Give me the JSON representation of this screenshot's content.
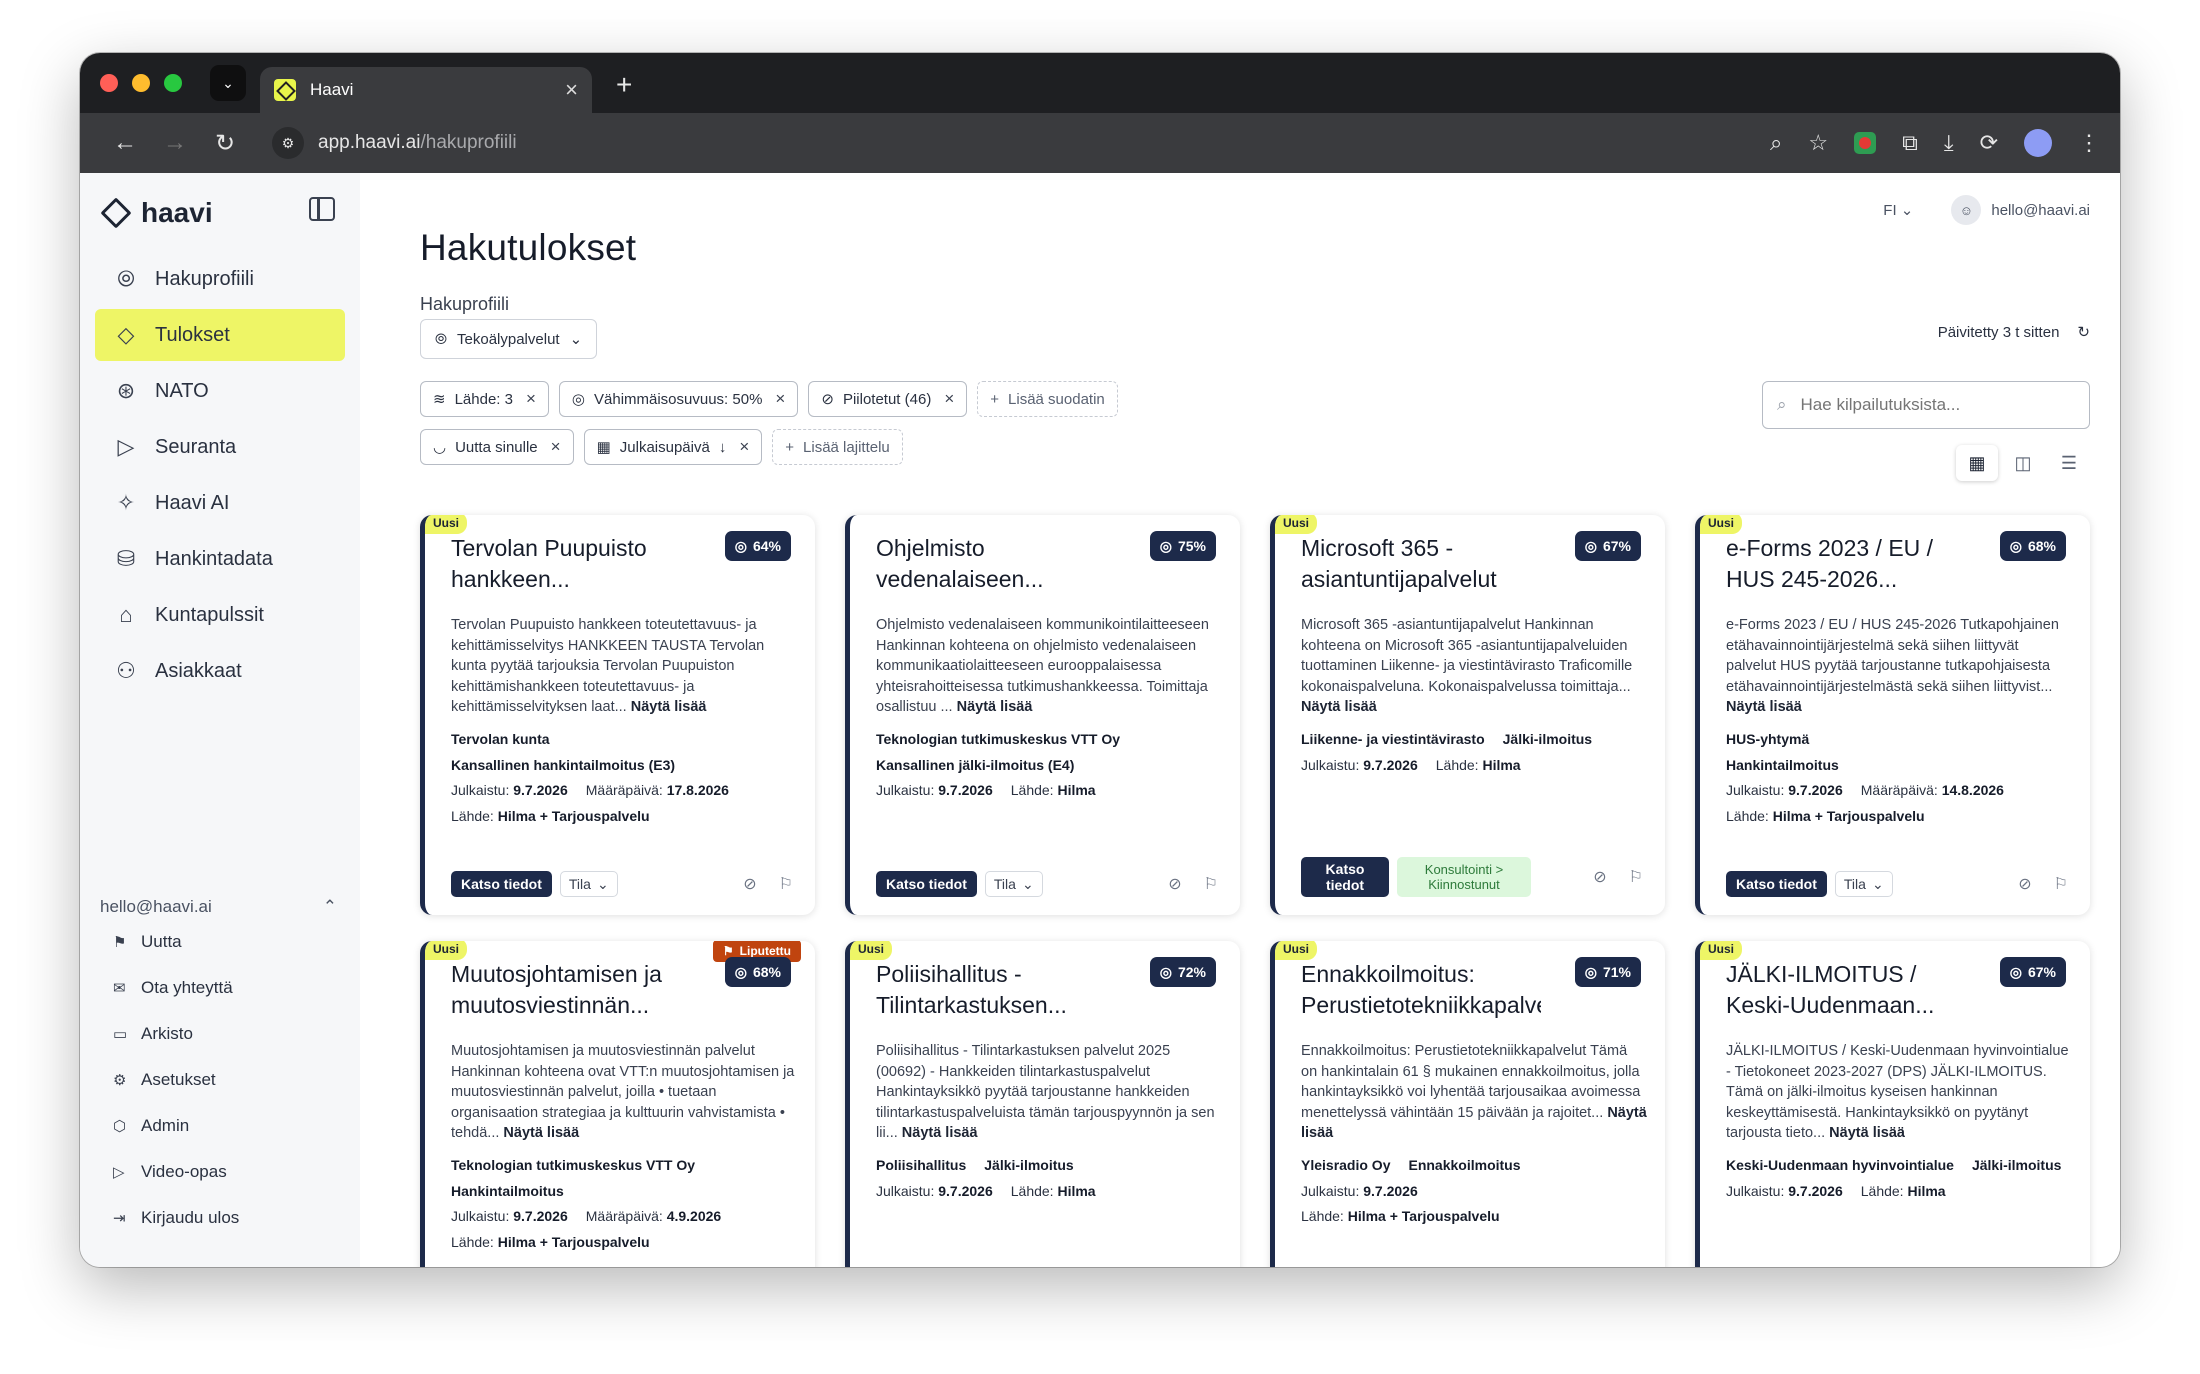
{
  "browser": {
    "tab_title": "Haavi",
    "url_host": "app.haavi.ai",
    "url_path": "/hakuprofiili"
  },
  "sidebar": {
    "logo": "haavi",
    "items": [
      {
        "label": "Hakuprofiili",
        "icon": "fingerprint-icon"
      },
      {
        "label": "Tulokset",
        "icon": "tag-icon"
      },
      {
        "label": "NATO",
        "icon": "compass-icon"
      },
      {
        "label": "Seuranta",
        "icon": "play-icon"
      },
      {
        "label": "Haavi AI",
        "icon": "sparkle-icon"
      },
      {
        "label": "Hankintadata",
        "icon": "database-icon"
      },
      {
        "label": "Kuntapulssit",
        "icon": "building-icon"
      },
      {
        "label": "Asiakkaat",
        "icon": "handshake-icon"
      }
    ],
    "account": {
      "email": "hello@haavi.ai",
      "items": [
        {
          "label": "Uutta",
          "icon": "megaphone-icon"
        },
        {
          "label": "Ota yhteyttä",
          "icon": "mail-icon"
        },
        {
          "label": "Arkisto",
          "icon": "archive-icon"
        },
        {
          "label": "Asetukset",
          "icon": "gear-icon"
        },
        {
          "label": "Admin",
          "icon": "shield-icon"
        },
        {
          "label": "Video-opas",
          "icon": "play-icon"
        },
        {
          "label": "Kirjaudu ulos",
          "icon": "logout-icon"
        }
      ]
    }
  },
  "header": {
    "lang": "FI",
    "user_email": "hello@haavi.ai",
    "title": "Hakutulokset",
    "profile_label": "Hakuprofiili",
    "profile_value": "Tekoälypalvelut",
    "updated": "Päivitetty 3 t sitten"
  },
  "filters": {
    "row1": [
      "Lähde: 3",
      "Vähimmäisosuvuus: 50%",
      "Piilotetut (46)"
    ],
    "add_filter": "Lisää suodatin",
    "row2": [
      "Uutta sinulle",
      "Julkaisupäivä"
    ],
    "add_sort": "Lisää lajittelu",
    "search_placeholder": "Hae kilpailutuksista..."
  },
  "labels": {
    "new": "Uusi",
    "show_more": "Näytä lisää",
    "details": "Katso tiedot",
    "status": "Tila",
    "flagged": "Liputettu",
    "published": "Julkaistu:",
    "deadline": "Määräpäivä:",
    "source": "Lähde:"
  },
  "cards": [
    {
      "new": true,
      "title": "Tervolan Puupuisto hankkeen...",
      "score": "64%",
      "desc": "Tervolan Puupuisto hankkeen toteutettavuus- ja kehittämisselvitys HANKKEEN TAUSTA Tervolan kunta pyytää tarjouksia Tervolan Puupuiston kehittämishankkeen toteutettavuus- ja kehittämisselvityksen laat...",
      "org": "Tervolan kunta",
      "type": "Kansallinen hankintailmoitus (E3)",
      "published": "9.7.2026",
      "deadline": "17.8.2026",
      "source": "Hilma + Tarjouspalvelu"
    },
    {
      "new": false,
      "title": "Ohjelmisto vedenalaiseen...",
      "score": "75%",
      "desc": "Ohjelmisto vedenalaiseen kommunikointilaitteeseen Hankinnan kohteena on ohjelmisto vedenalaiseen kommunikaatiolaitteeseen eurooppalaisessa yhteisrahoitteisessa tutkimushankkeessa. Toimittaja osallistuu ...",
      "org": "Teknologian tutkimuskeskus VTT Oy",
      "type": "Kansallinen jälki-ilmoitus (E4)",
      "published": "9.7.2026",
      "source": "Hilma"
    },
    {
      "new": true,
      "title": "Microsoft 365 - asiantuntijapalvelut",
      "score": "67%",
      "desc": "Microsoft 365 -asiantuntijapalvelut Hankinnan kohteena on Microsoft 365 -asiantuntijapalveluiden tuottaminen Liikenne- ja viestintävirasto Traficomille kokonaispalveluna. Kokonaispalvelussa toimittaja...",
      "org": "Liikenne- ja viestintävirasto",
      "type": "Jälki-ilmoitus",
      "published": "9.7.2026",
      "source": "Hilma",
      "status_label": "Konsultointi > Kiinnostunut"
    },
    {
      "new": true,
      "title": "e-Forms 2023 / EU / HUS 245-2026...",
      "score": "68%",
      "desc": "e-Forms 2023 / EU / HUS 245-2026 Tutkapohjainen etähavainnointijärjestelmä sekä siihen liittyvät palvelut HUS pyytää tarjoustanne tutkapohjaisesta etähavainnointijärjestelmästä sekä siihen liittyvist...",
      "org": "HUS-yhtymä",
      "type": "Hankintailmoitus",
      "published": "9.7.2026",
      "deadline": "14.8.2026",
      "source": "Hilma + Tarjouspalvelu"
    },
    {
      "new": true,
      "flagged": true,
      "title": "Muutosjohtamisen ja muutosviestinnän...",
      "score": "68%",
      "desc": "Muutosjohtamisen ja muutosviestinnän palvelut Hankinnan kohteena ovat VTT:n muutosjohtamisen ja muutosviestinnän palvelut, joilla • tuetaan organisaation strategiaa ja kulttuurin vahvistamista • tehdä...",
      "org": "Teknologian tutkimuskeskus VTT Oy",
      "type": "Hankintailmoitus",
      "published": "9.7.2026",
      "deadline": "4.9.2026",
      "source": "Hilma + Tarjouspalvelu"
    },
    {
      "new": true,
      "title": "Poliisihallitus - Tilintarkastuksen...",
      "score": "72%",
      "desc": "Poliisihallitus - Tilintarkastuksen palvelut 2025 (00692) - Hankkeiden tilintarkastuspalvelut Hankintayksikkö pyytää tarjoustanne hankkeiden tilintarkastuspalveluista tämän tarjouspyynnön ja sen lii...",
      "org": "Poliisihallitus",
      "type": "Jälki-ilmoitus",
      "published": "9.7.2026",
      "source": "Hilma"
    },
    {
      "new": true,
      "title": "Ennakkoilmoitus: Perustietotekniikkapalvelut",
      "score": "71%",
      "desc": "Ennakkoilmoitus: Perustietotekniikkapalvelut Tämä on hankintalain 61 § mukainen ennakkoilmoitus, jolla hankintayksikkö voi lyhentää tarjousaikaa avoimessa menettelyssä vähintään 15 päivään ja rajoitet...",
      "org": "Yleisradio Oy",
      "type": "Ennakkoilmoitus",
      "published": "9.7.2026",
      "source": "Hilma + Tarjouspalvelu"
    },
    {
      "new": true,
      "title": "JÄLKI-ILMOITUS / Keski-Uudenmaan...",
      "score": "67%",
      "desc": "JÄLKI-ILMOITUS / Keski-Uudenmaan hyvinvointialue - Tietokoneet 2023-2027 (DPS) JÄLKI-ILMOITUS. Tämä on jälki-ilmoitus kyseisen hankinnan keskeyttämisestä. Hankintayksikkö on pyytänyt tarjousta tieto...",
      "org": "Keski-Uudenmaan hyvinvointialue",
      "type": "Jälki-ilmoitus",
      "published": "9.7.2026",
      "source": "Hilma"
    }
  ]
}
